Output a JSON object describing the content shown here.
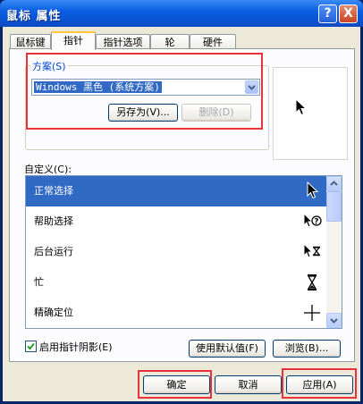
{
  "window": {
    "title": "鼠标 属性",
    "help_glyph": "?",
    "close_glyph": "X"
  },
  "tabs": [
    {
      "label": "鼠标键"
    },
    {
      "label": "指针",
      "active": true
    },
    {
      "label": "指针选项"
    },
    {
      "label": "轮"
    },
    {
      "label": "硬件"
    }
  ],
  "scheme": {
    "label": "方案(S)",
    "selected": "Windows 黑色 (系统方案)",
    "save_as_button": "另存为(V)...",
    "delete_button": "删除(D)"
  },
  "customize": {
    "label": "自定义(C):",
    "items": [
      {
        "label": "正常选择",
        "icon": "arrow-pointer-icon",
        "selected": true
      },
      {
        "label": "帮助选择",
        "icon": "help-pointer-icon",
        "selected": false
      },
      {
        "label": "后台运行",
        "icon": "working-in-background-icon",
        "selected": false
      },
      {
        "label": "忙",
        "icon": "hourglass-icon",
        "selected": false
      },
      {
        "label": "精确定位",
        "icon": "crosshair-icon",
        "selected": false
      }
    ]
  },
  "shadow_checkbox": {
    "label": "启用指针阴影(E)",
    "checked": true
  },
  "buttons": {
    "use_default": "使用默认值(F)",
    "browse": "浏览(B)...",
    "ok": "确定",
    "cancel": "取消",
    "apply": "应用(A)"
  },
  "colors": {
    "selection": "#316ac5",
    "highlight_box": "#e8323c",
    "title_bar": "#0b5fe3"
  }
}
